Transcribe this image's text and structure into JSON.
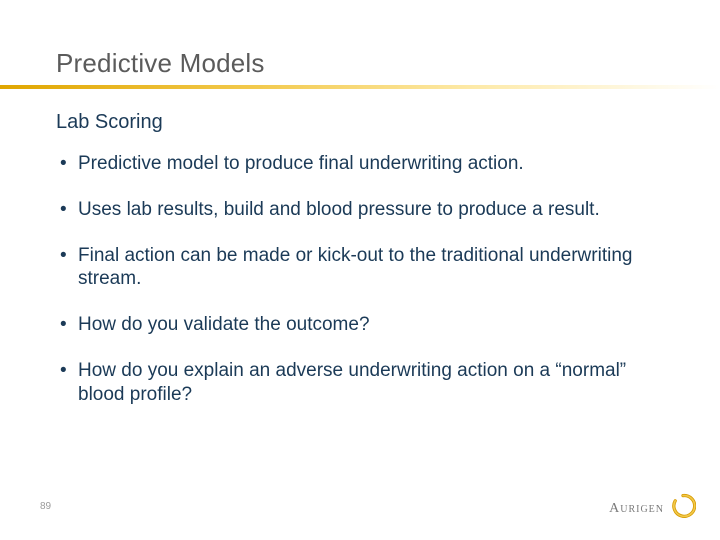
{
  "title": "Predictive Models",
  "subtitle": "Lab Scoring",
  "bullets": [
    "Predictive model to produce final underwriting action.",
    "Uses lab results, build and blood pressure to produce a result.",
    "Final action can be made or kick-out to the traditional underwriting stream.",
    "How do you validate the outcome?",
    "How do you explain an adverse underwriting action on a “normal” blood profile?"
  ],
  "page_number": "89",
  "logo_text": "Aurigen"
}
